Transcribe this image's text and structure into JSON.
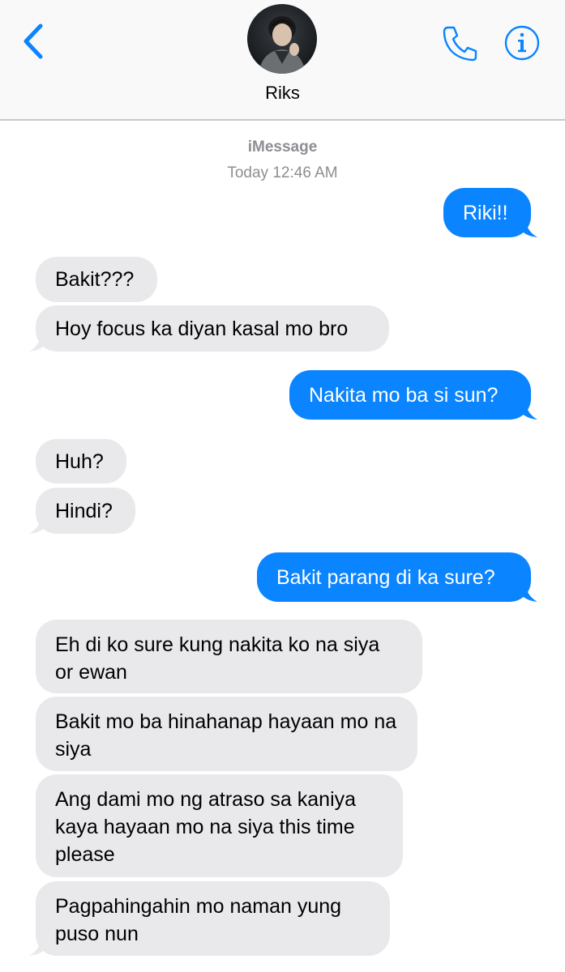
{
  "header": {
    "contact_name": "Riks"
  },
  "meta": {
    "service": "iMessage",
    "timestamp": "Today 12:46 AM"
  },
  "colors": {
    "accent": "#0a84ff",
    "incoming_bubble": "#e9e9eb",
    "meta_text": "#8e8e93"
  },
  "icons": {
    "back": "chevron-left-icon",
    "call": "phone-icon",
    "info": "info-icon"
  },
  "messages": [
    {
      "from": "me",
      "text": "Riki!!"
    },
    {
      "from": "them",
      "text": "Bakit???"
    },
    {
      "from": "them",
      "text": "Hoy focus ka diyan kasal mo bro"
    },
    {
      "from": "me",
      "text": "Nakita mo ba si sun?"
    },
    {
      "from": "them",
      "text": "Huh?"
    },
    {
      "from": "them",
      "text": "Hindi?"
    },
    {
      "from": "me",
      "text": "Bakit parang di ka sure?"
    },
    {
      "from": "them",
      "text": "Eh di ko sure kung nakita ko na siya or ewan"
    },
    {
      "from": "them",
      "text": "Bakit mo ba hinahanap hayaan mo na siya"
    },
    {
      "from": "them",
      "text": "Ang dami mo ng atraso sa kaniya kaya hayaan mo na siya this time please"
    },
    {
      "from": "them",
      "text": "Pagpahingahin mo naman yung puso nun"
    }
  ]
}
